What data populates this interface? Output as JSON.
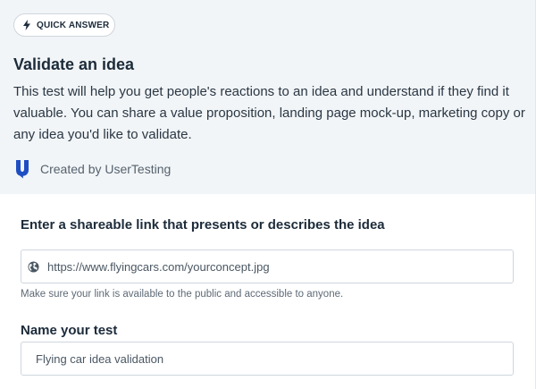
{
  "header": {
    "badge_label": "QUICK ANSWER",
    "title": "Validate an idea",
    "description": "This test will help you get people's reactions to an idea and understand if they find it valuable. You can share a value proposition, landing page mock-up, marketing copy or any idea you'd like to validate.",
    "created_by": "Created by UserTesting",
    "brand_color": "#1f4ec2"
  },
  "link_field": {
    "label": "Enter a shareable link that presents or describes the idea",
    "value": "https://www.flyingcars.com/yourconcept.jpg",
    "help": "Make sure your link is available to the public and accessible to anyone.",
    "icon": "globe-icon"
  },
  "name_field": {
    "label": "Name your test",
    "value": "Flying car idea validation"
  }
}
